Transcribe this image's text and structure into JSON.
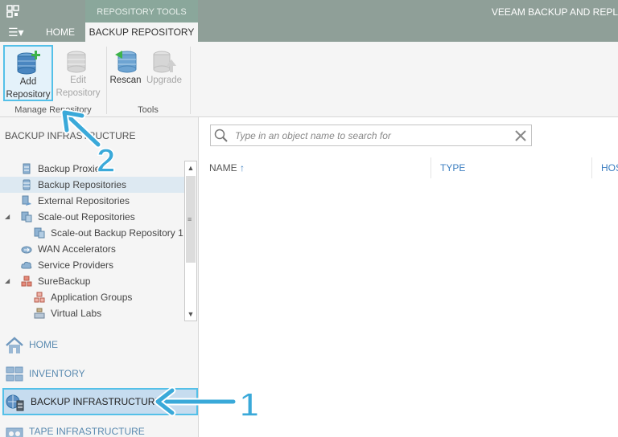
{
  "titlebar": {
    "context_group": "REPOSITORY TOOLS",
    "window_title": "VEEAM BACKUP AND REPL",
    "tabs": {
      "home": "HOME",
      "backup_repository": "BACKUP REPOSITORY"
    }
  },
  "ribbon": {
    "add_repository": {
      "line1": "Add",
      "line2": "Repository"
    },
    "edit_repository": {
      "line1": "Edit",
      "line2": "Repository"
    },
    "rescan": "Rescan",
    "upgrade": "Upgrade",
    "group_manage": "Manage Repository",
    "group_tools": "Tools"
  },
  "left_pane": {
    "section_title": "BACKUP INFRASTRUCTURE",
    "tree": [
      {
        "label": "Backup Proxies",
        "icon": "server-icon"
      },
      {
        "label": "Backup Repositories",
        "icon": "database-icon",
        "selected": true
      },
      {
        "label": "External Repositories",
        "icon": "external-repository-icon"
      },
      {
        "label": "Scale-out Repositories",
        "icon": "scale-out-icon",
        "expandable": true
      },
      {
        "label": "Scale-out Backup Repository 1",
        "icon": "scale-out-icon"
      },
      {
        "label": "WAN Accelerators",
        "icon": "wan-accelerator-icon"
      },
      {
        "label": "Service Providers",
        "icon": "cloud-icon"
      },
      {
        "label": "SureBackup",
        "icon": "surebackup-icon",
        "expandable": true
      },
      {
        "label": "Application Groups",
        "icon": "application-group-icon"
      },
      {
        "label": "Virtual Labs",
        "icon": "virtual-lab-icon"
      }
    ],
    "nav": {
      "home": "HOME",
      "inventory": "INVENTORY",
      "backup_infrastructure": "BACKUP INFRASTRUCTURE",
      "tape_infrastructure": "TAPE INFRASTRUCTURE"
    }
  },
  "main": {
    "search_placeholder": "Type in an object name to search for",
    "columns": {
      "name": "NAME",
      "type": "TYPE",
      "host": "HOS"
    }
  },
  "annotations": {
    "step1": "1",
    "step2": "2"
  },
  "colors": {
    "titlebar": "#8f9f98",
    "context_group": "#8aa79b",
    "highlight_border": "#54c0e8",
    "selected_row": "#dde9f2",
    "nav_text": "#5a8ab0",
    "column_header": "#3b7ec0"
  }
}
